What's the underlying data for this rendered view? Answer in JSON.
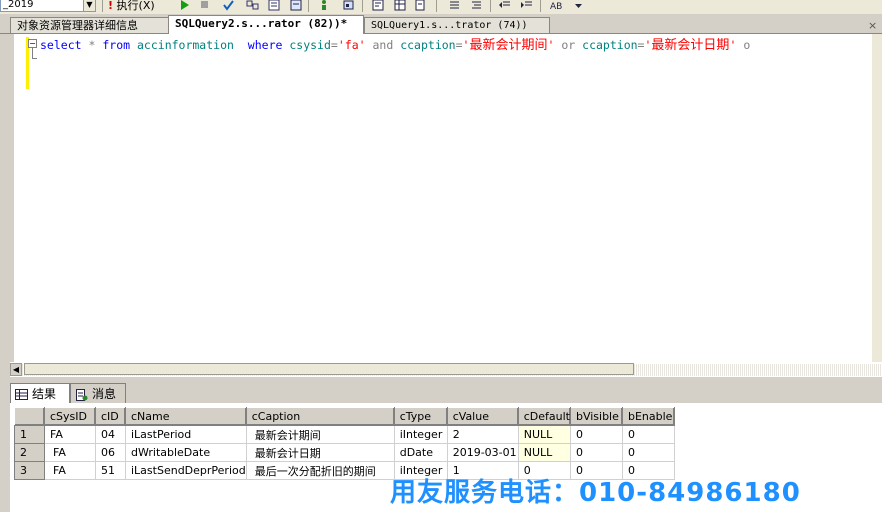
{
  "toolbar": {
    "database_value": "_2019",
    "execute_label": "执行(X)",
    "execute_mark": "!",
    "run_icon": "play-icon",
    "stop_icon": "stop-icon",
    "parse_icon": "check-icon"
  },
  "tabs": [
    {
      "label": "对象资源管理器详细信息",
      "active": false
    },
    {
      "label": "SQLQuery2.s...rator (82))*",
      "active": true
    },
    {
      "label": "SQLQuery1.s...trator (74))",
      "active": false
    }
  ],
  "tab_close": "×",
  "editor": {
    "fold_marker": "−",
    "code": {
      "kw_select": "select",
      "star": "*",
      "kw_from": "from",
      "table": "accinformation",
      "kw_where": "where",
      "col1": "csysid",
      "eq1": "=",
      "str1": "'fa'",
      "kw_and": "and",
      "col2": "ccaption",
      "eq2": "=",
      "str2_q1": "'",
      "str2_text": "最新会计期间",
      "str2_q2": "'",
      "kw_or": "or",
      "col3": "ccaption",
      "eq3": "=",
      "str3_q1": "'",
      "str3_text": "最新会计日期",
      "str3_q2": "'",
      "kw_o": "o"
    }
  },
  "result_tabs": [
    {
      "label": "结果",
      "icon": "grid-icon",
      "active": true
    },
    {
      "label": "消息",
      "icon": "message-icon",
      "active": false
    }
  ],
  "grid": {
    "columns": [
      "cSysID",
      "cID",
      "cName",
      "cCaption",
      "cType",
      "cValue",
      "cDefault",
      "bVisible",
      "bEnable"
    ],
    "rows": [
      {
        "num": "1",
        "cells": [
          "FA",
          "04",
          "iLastPeriod",
          "最新会计期间",
          "iInteger",
          "2",
          "NULL",
          "0",
          "0"
        ]
      },
      {
        "num": "2",
        "cells": [
          "FA",
          "06",
          "dWritableDate",
          "最新会计日期",
          "dDate",
          "2019-03-01",
          "NULL",
          "0",
          "0"
        ]
      },
      {
        "num": "3",
        "cells": [
          "FA",
          "51",
          "iLastSendDeprPeriod",
          "最后一次分配折旧的期间",
          "iInteger",
          "1",
          "0",
          "0",
          "0"
        ]
      }
    ]
  },
  "watermark": "用友服务电话：010-84986180",
  "colors": {
    "keyword": "#0000ff",
    "string": "#ff0000",
    "identifier": "#008080",
    "operator": "#808080",
    "null_cell_bg": "#ffffe1",
    "watermark": "#1e90ff"
  }
}
